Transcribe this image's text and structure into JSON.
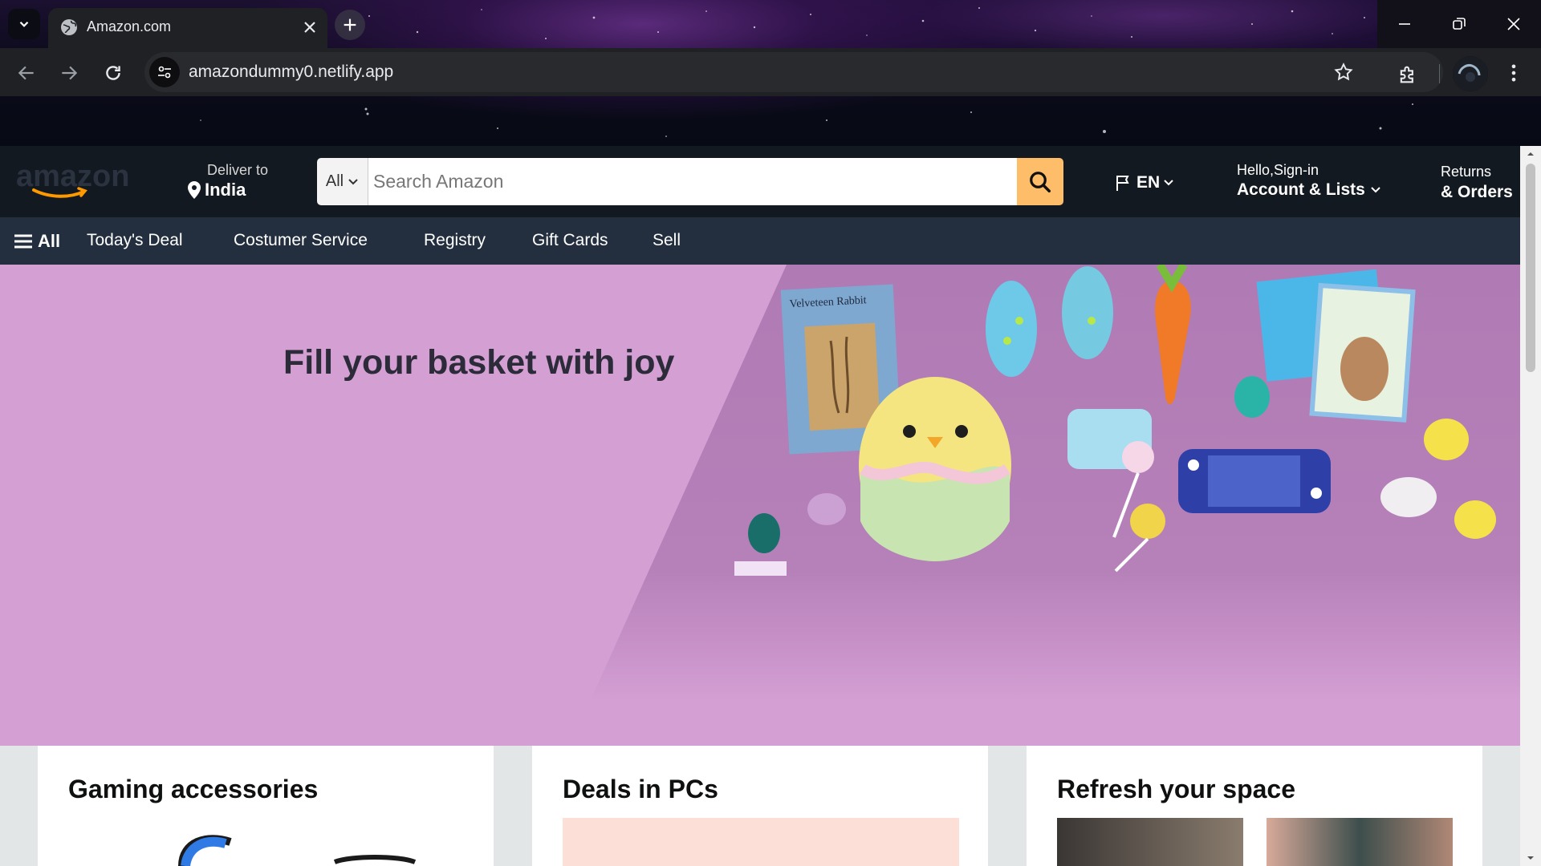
{
  "browser": {
    "tab_title": "Amazon.com",
    "url": "amazondummy0.netlify.app"
  },
  "header": {
    "deliver_label": "Deliver to",
    "deliver_location": "India",
    "search_category": "All",
    "search_placeholder": "Search Amazon",
    "language": "EN",
    "greeting": "Hello,Sign-in",
    "account_label": "Account & Lists",
    "returns_label": "Returns",
    "orders_label": "& Orders"
  },
  "subnav": {
    "all_label": "All",
    "links": [
      "Today's Deal",
      "Costumer Service",
      "Registry",
      "Gift Cards",
      "Sell"
    ]
  },
  "hero": {
    "title": "Fill your basket with joy",
    "book_title": "Velveteen Rabbit"
  },
  "cards": [
    {
      "title": "Gaming accessories"
    },
    {
      "title": "Deals in PCs"
    },
    {
      "title": "Refresh your space"
    }
  ],
  "colors": {
    "nav_bg": "#131921",
    "subnav_bg": "#232f3e",
    "search_button": "#febd69",
    "hero_bg": "#d49fd3",
    "glitter": "#b07ab4"
  }
}
